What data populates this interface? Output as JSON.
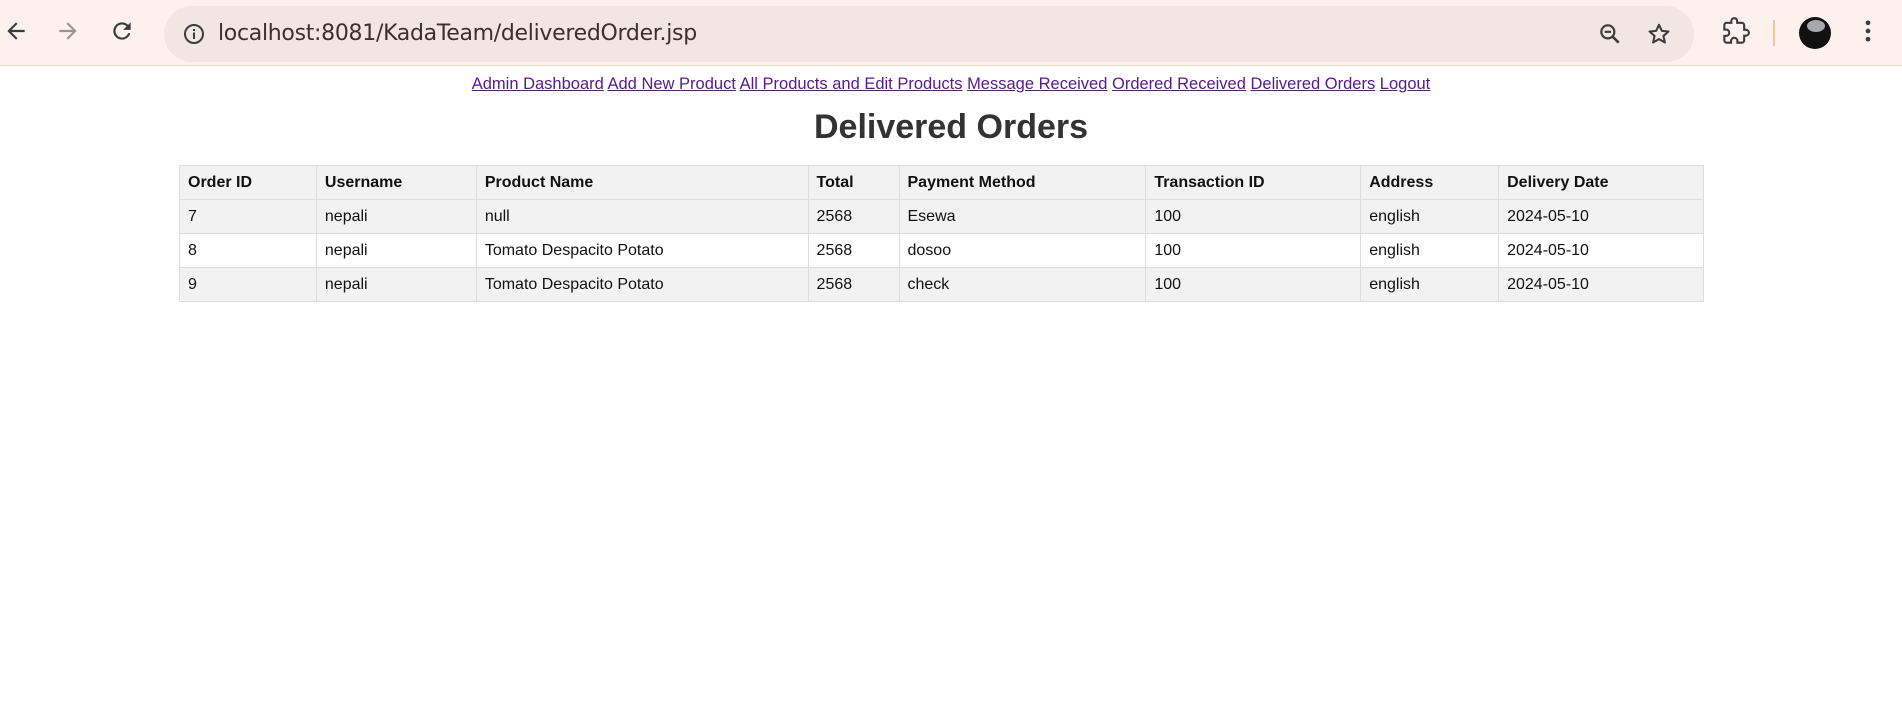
{
  "browser": {
    "url": "localhost:8081/KadaTeam/deliveredOrder.jsp",
    "icons": [
      "back-icon",
      "forward-icon",
      "reload-icon",
      "site-info-icon",
      "zoom-icon",
      "star-icon",
      "extensions-icon",
      "avatar",
      "menu-kebab-icon"
    ]
  },
  "nav": {
    "links": [
      "Admin Dashboard",
      "Add New Product",
      "All Products and Edit Products",
      "Message Received",
      "Ordered Received",
      "Delivered Orders",
      "Logout"
    ]
  },
  "page": {
    "title": "Delivered Orders"
  },
  "table": {
    "headers": [
      "Order ID",
      "Username",
      "Product Name",
      "Total",
      "Payment Method",
      "Transaction ID",
      "Address",
      "Delivery Date"
    ],
    "rows": [
      [
        "7",
        "nepali",
        "null",
        "2568",
        "Esewa",
        "100",
        "english",
        "2024-05-10"
      ],
      [
        "8",
        "nepali",
        "Tomato Despacito Potato",
        "2568",
        "dosoo",
        "100",
        "english",
        "2024-05-10"
      ],
      [
        "9",
        "nepali",
        "Tomato Despacito Potato",
        "2568",
        "check",
        "100",
        "english",
        "2024-05-10"
      ]
    ]
  },
  "colors": {
    "chrome_bg": "#fdf1ee",
    "omnibox_bg": "#f2e6e2",
    "link": "#551a8b",
    "header_bg": "#f2f2f2",
    "border": "#dddddd"
  }
}
